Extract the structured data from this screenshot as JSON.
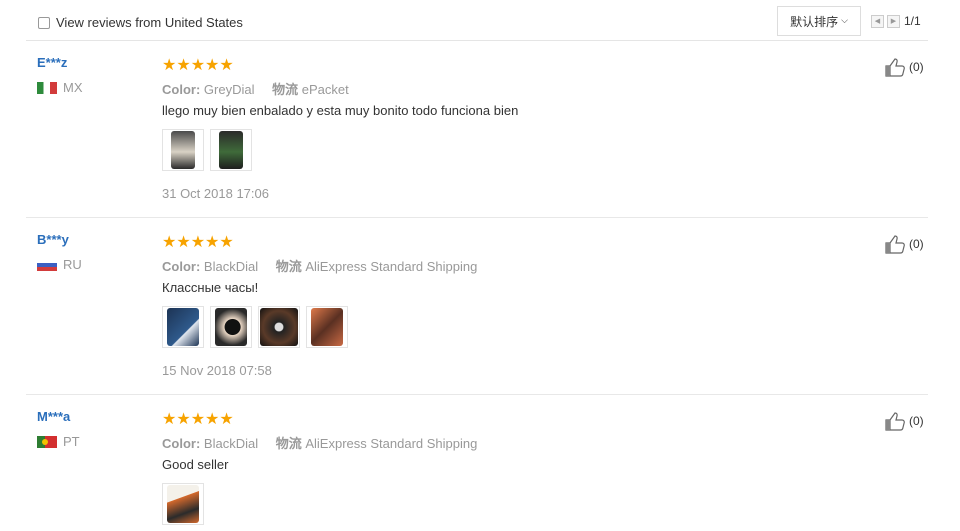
{
  "toolbar": {
    "filter_label": "View reviews from United States",
    "sort_label": "默认排序",
    "page_indicator": "1/1"
  },
  "reviews": [
    {
      "user": "E***z",
      "country": "MX",
      "rating": 5,
      "color_key": "Color:",
      "color_value": "GreyDial",
      "ship_key": "物流",
      "ship_value": "ePacket",
      "text": "llego muy bien enbalado y esta muy bonito todo funciona bien",
      "date": "31 Oct 2018 17:06",
      "likes": "(0)",
      "photos": [
        "#3a3a3a",
        "#2f3b2a"
      ]
    },
    {
      "user": "B***y",
      "country": "RU",
      "rating": 5,
      "color_key": "Color:",
      "color_value": "BlackDial",
      "ship_key": "物流",
      "ship_value": "AliExpress Standard Shipping",
      "text": "Классные часы!",
      "date": "15 Nov 2018 07:58",
      "likes": "(0)",
      "photos": [
        "#1f3f6a",
        "#222222",
        "#3a2a20",
        "#b05a3a"
      ]
    },
    {
      "user": "M***a",
      "country": "PT",
      "rating": 5,
      "color_key": "Color:",
      "color_value": "BlackDial",
      "ship_key": "物流",
      "ship_value": "AliExpress Standard Shipping",
      "text": "Good seller",
      "date": "",
      "likes": "(0)",
      "photos": [
        "#c8602a"
      ]
    }
  ]
}
